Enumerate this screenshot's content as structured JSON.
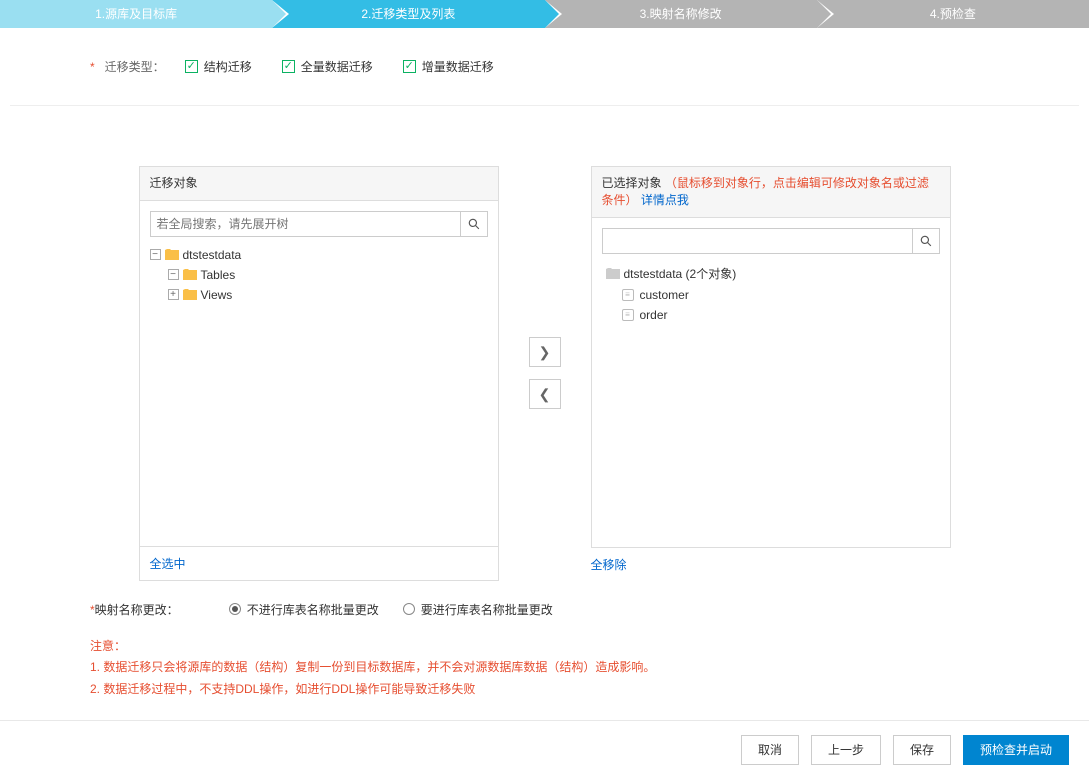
{
  "steps": {
    "s1": "1.源库及目标库",
    "s2": "2.迁移类型及列表",
    "s3": "3.映射名称修改",
    "s4": "4.预检查"
  },
  "migrationType": {
    "label": "迁移类型：",
    "options": {
      "structure": "结构迁移",
      "full": "全量数据迁移",
      "incremental": "增量数据迁移"
    }
  },
  "source": {
    "title": "迁移对象",
    "search_placeholder": "若全局搜索，请先展开树",
    "tree": {
      "db": "dtstestdata",
      "tables": "Tables",
      "views": "Views"
    },
    "foot": "全选中"
  },
  "target": {
    "title": "已选择对象",
    "hint": "（鼠标移到对象行，点击编辑可修改对象名或过滤条件）",
    "link": "详情点我",
    "tree": {
      "db": "dtstestdata (2个对象)",
      "customer": "customer",
      "order": "order"
    },
    "foot": "全移除"
  },
  "rename": {
    "label": "映射名称更改：",
    "opt_no": "不进行库表名称批量更改",
    "opt_yes": "要进行库表名称批量更改"
  },
  "notice": {
    "head": "注意：",
    "l1": "1. 数据迁移只会将源库的数据（结构）复制一份到目标数据库，并不会对源数据库数据（结构）造成影响。",
    "l2": "2. 数据迁移过程中，不支持DDL操作，如进行DDL操作可能导致迁移失败"
  },
  "footer": {
    "cancel": "取消",
    "prev": "上一步",
    "save": "保存",
    "precheck": "预检查并启动"
  }
}
